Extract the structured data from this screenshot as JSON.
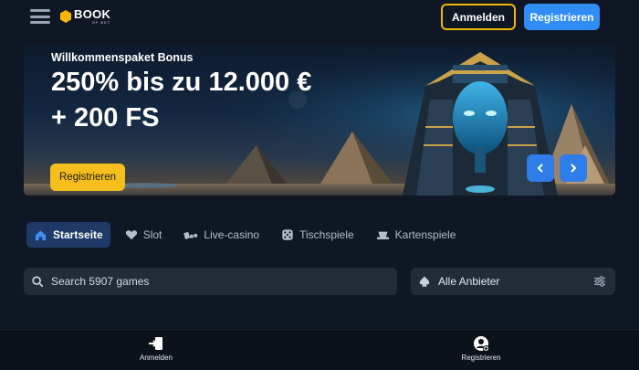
{
  "header": {
    "logo_main": "BOOK",
    "logo_sub": "OF BET",
    "login_label": "Anmelden",
    "register_label": "Registrieren"
  },
  "banner": {
    "eyebrow": "Willkommenspaket Bonus",
    "line1": "250% bis zu 12.000 €",
    "line2": "+ 200 FS",
    "cta_label": "Registrieren"
  },
  "tabs": [
    {
      "label": "Startseite",
      "icon": "home-icon",
      "active": true
    },
    {
      "label": "Slot",
      "icon": "heart-icon",
      "active": false
    },
    {
      "label": "Live-casino",
      "icon": "cards-chips-icon",
      "active": false
    },
    {
      "label": "Tischspiele",
      "icon": "dice-icon",
      "active": false
    },
    {
      "label": "Kartenspiele",
      "icon": "card-hat-icon",
      "active": false
    }
  ],
  "search": {
    "placeholder": "Search 5907 games"
  },
  "provider": {
    "label": "Alle Anbieter"
  },
  "bottom_nav": {
    "login_label": "Anmelden",
    "register_label": "Registrieren"
  },
  "colors": {
    "background": "#0f1724",
    "accent_blue": "#2f8df5",
    "accent_yellow": "#f2b705",
    "active_tab": "#1f3a66",
    "input_bg": "#222b38"
  }
}
